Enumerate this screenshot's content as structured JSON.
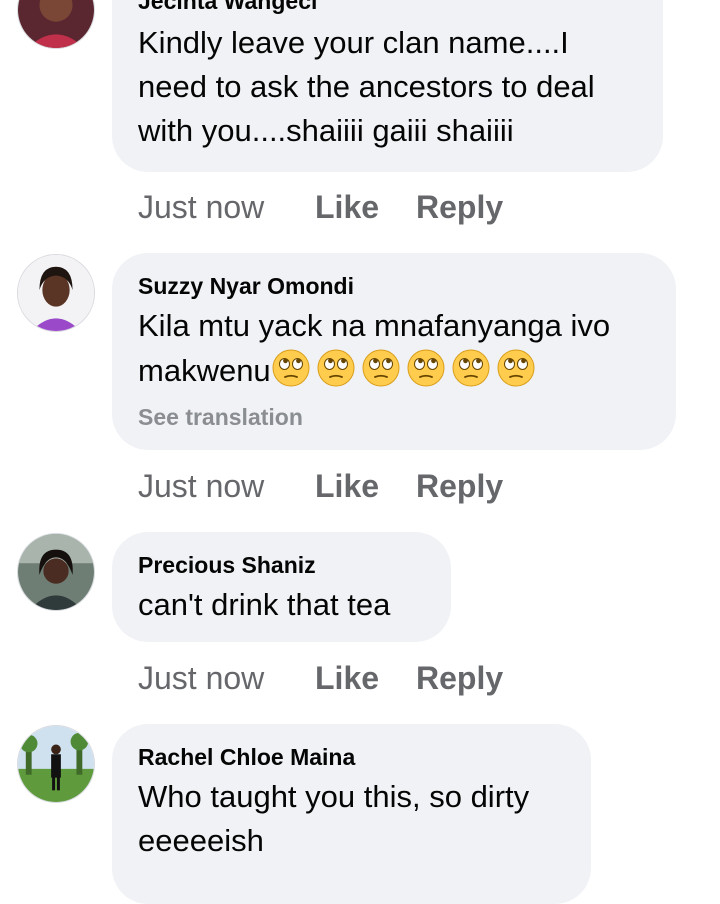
{
  "comments": [
    {
      "author": "Jecinta Wangeci",
      "text": "Kindly leave your clan name....I need to ask the ancestors to deal with you....shaiiii gaiii shaiiii",
      "lines": [
        "Kindly leave your clan name....I",
        "need to ask the ancestors to deal",
        "with you....shaiiii gaiii shaiiii"
      ],
      "time": "Just now",
      "like_label": "Like",
      "reply_label": "Reply"
    },
    {
      "author": "Suzzy Nyar Omondi",
      "lines": [
        "Kila mtu yack na mnafanyanga ivo",
        "makwenu"
      ],
      "emojis": [
        "face-with-rolling-eyes-emoji",
        "face-with-rolling-eyes-emoji",
        "face-with-rolling-eyes-emoji",
        "face-with-rolling-eyes-emoji",
        "face-with-rolling-eyes-emoji",
        "face-with-rolling-eyes-emoji"
      ],
      "see_translation": "See translation",
      "time": "Just now",
      "like_label": "Like",
      "reply_label": "Reply"
    },
    {
      "author": "Precious Shaniz",
      "lines": [
        "can't drink that tea"
      ],
      "time": "Just now",
      "like_label": "Like",
      "reply_label": "Reply"
    },
    {
      "author": "Rachel Chloe Maina",
      "lines": [
        "Who taught you this, so dirty",
        "eeeeeish"
      ]
    }
  ],
  "colors": {
    "bubble": "#f0f2f5",
    "secondary_text": "#65676b",
    "translation_text": "#8a8d91",
    "primary_text": "#050505"
  }
}
